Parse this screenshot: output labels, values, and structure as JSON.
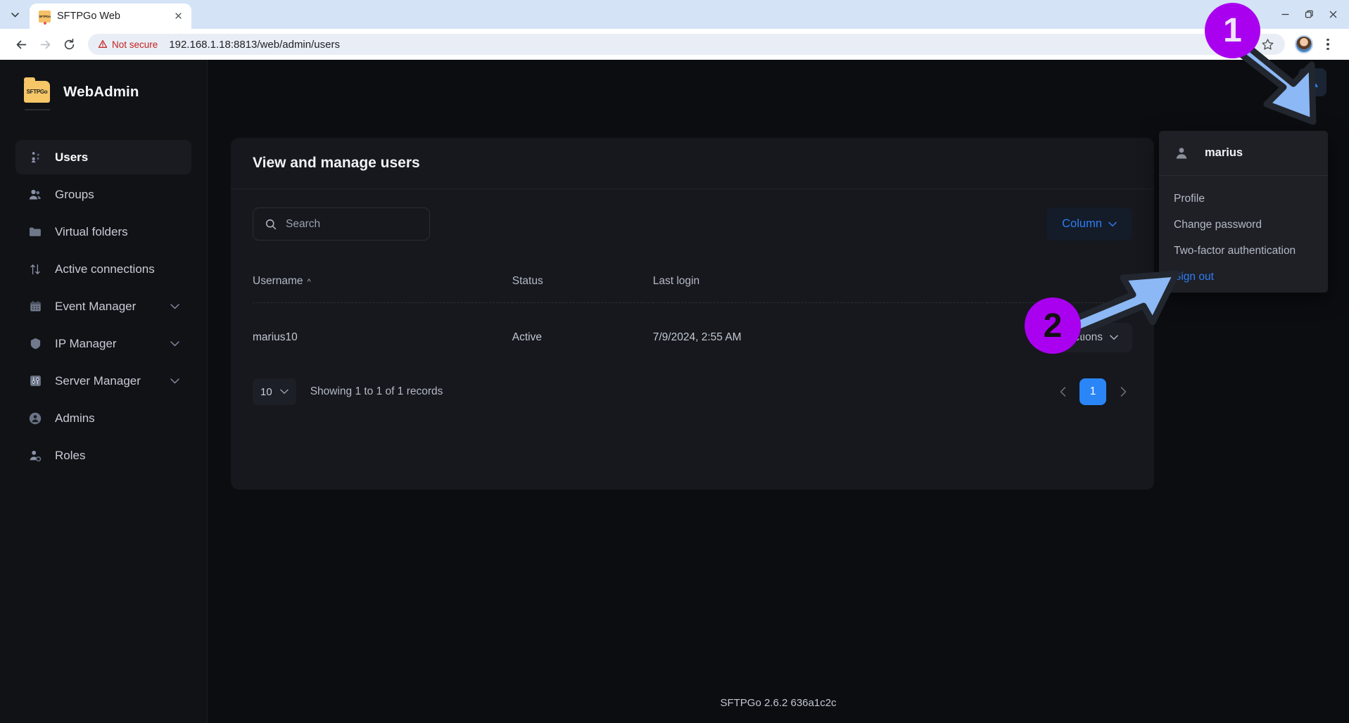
{
  "browser": {
    "tab": {
      "title": "SFTPGo Web",
      "favicon_text": "SFTPGo",
      "close_icon": "close-icon"
    },
    "tab_list_icon": "chevron-down-icon",
    "nav": {
      "back_icon": "back-arrow-icon",
      "forward_icon": "forward-arrow-icon",
      "reload_icon": "reload-icon"
    },
    "omnibox": {
      "security_label": "Not secure",
      "security_icon": "warning-triangle-icon",
      "url": "192.168.1.18:8813/web/admin/users",
      "password_icon": "key-icon",
      "bookmark_icon": "star-icon"
    },
    "profile_icon": "chrome-profile-avatar",
    "menu_icon": "kebab-menu-icon",
    "window": {
      "minimize": "minimize-icon",
      "maximize": "maximize-icon",
      "close": "close-icon"
    }
  },
  "sidebar": {
    "brand": {
      "name": "WebAdmin",
      "logo_text": "SFTPGo"
    },
    "items": [
      {
        "label": "Users",
        "icon": "users-icon",
        "active": true,
        "expandable": false
      },
      {
        "label": "Groups",
        "icon": "groups-icon",
        "active": false,
        "expandable": false
      },
      {
        "label": "Virtual folders",
        "icon": "folder-icon",
        "active": false,
        "expandable": false
      },
      {
        "label": "Active connections",
        "icon": "transfer-arrows-icon",
        "active": false,
        "expandable": false
      },
      {
        "label": "Event Manager",
        "icon": "calendar-icon",
        "active": false,
        "expandable": true
      },
      {
        "label": "IP Manager",
        "icon": "shield-icon",
        "active": false,
        "expandable": true
      },
      {
        "label": "Server Manager",
        "icon": "sliders-icon",
        "active": false,
        "expandable": true
      },
      {
        "label": "Admins",
        "icon": "admin-badge-icon",
        "active": false,
        "expandable": false
      },
      {
        "label": "Roles",
        "icon": "role-user-icon",
        "active": false,
        "expandable": false
      }
    ]
  },
  "topbar": {
    "theme_toggle_icon": "moon-icon",
    "user_icon": "user-avatar-icon"
  },
  "card": {
    "title": "View and manage users",
    "search": {
      "placeholder": "Search",
      "value": "",
      "icon": "search-icon"
    },
    "column_button": {
      "label": "Column",
      "icon": "chevron-down-icon"
    },
    "table": {
      "columns": [
        "Username",
        "Status",
        "Last login",
        ""
      ],
      "sort_column": "Username",
      "sort_direction": "asc",
      "sort_icon": "caret-up-icon",
      "rows": [
        {
          "username": "marius10",
          "status": "Active",
          "last_login": "7/9/2024, 2:55 AM",
          "action_label": "Actions",
          "action_icon": "chevron-down-icon"
        }
      ]
    },
    "pagination": {
      "page_size": "10",
      "page_size_icon": "chevron-down-icon",
      "records_text": "Showing 1 to 1 of 1 records",
      "prev_icon": "chevron-left-icon",
      "next_icon": "chevron-right-icon",
      "current_page": "1"
    }
  },
  "user_menu": {
    "username": "marius",
    "avatar_icon": "user-icon",
    "items": [
      {
        "label": "Profile",
        "highlight": false
      },
      {
        "label": "Change password",
        "highlight": false
      },
      {
        "label": "Two-factor authentication",
        "highlight": false
      },
      {
        "label": "Sign out",
        "highlight": true
      }
    ]
  },
  "footer": {
    "text": "SFTPGo 2.6.2 636a1c2c"
  },
  "annotations": {
    "accent_purple": "#aa00f0",
    "arrow_fill": "#8cb8f5",
    "arrow_stroke": "#22262e",
    "steps": [
      {
        "number": "1",
        "target": "user-avatar-icon"
      },
      {
        "number": "2",
        "target": "sign-out-menu-item"
      }
    ]
  }
}
